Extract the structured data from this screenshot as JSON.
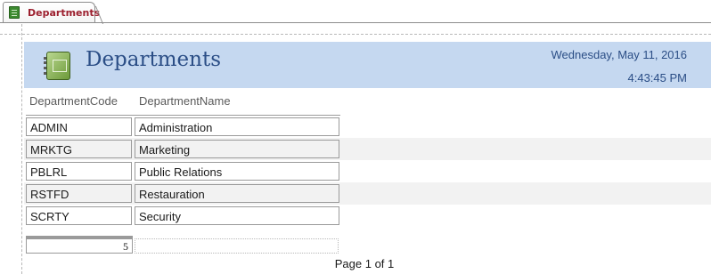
{
  "tab": {
    "label": "Departments",
    "icon": "report-icon"
  },
  "report": {
    "title": "Departments",
    "logo_icon": "notebook-icon",
    "date": "Wednesday, May 11, 2016",
    "time": "4:43:45 PM",
    "header_color": "#c5d8f0",
    "title_color": "#2b4e86"
  },
  "columns": [
    "DepartmentCode",
    "DepartmentName"
  ],
  "rows": [
    {
      "code": "ADMIN",
      "name": "Administration"
    },
    {
      "code": "MRKTG",
      "name": "Marketing"
    },
    {
      "code": "PBLRL",
      "name": "Public Relations"
    },
    {
      "code": "RSTFD",
      "name": "Restauration"
    },
    {
      "code": "SCRTY",
      "name": "Security"
    }
  ],
  "footer": {
    "count": "5",
    "page": "Page 1 of 1"
  }
}
